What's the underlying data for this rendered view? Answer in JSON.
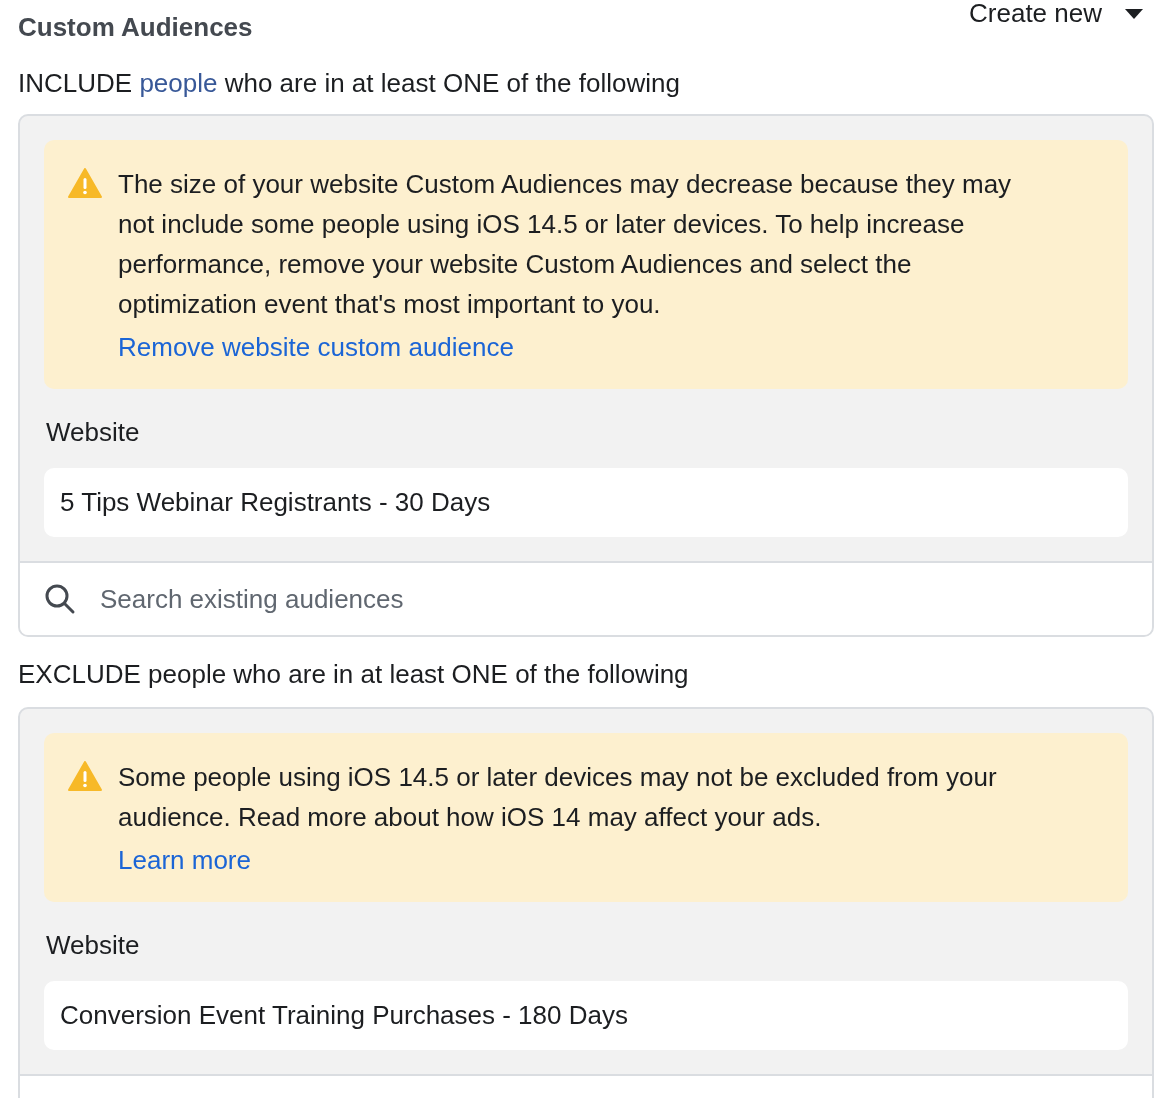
{
  "title": "Custom Audiences",
  "create_button": {
    "label": "Create new"
  },
  "sections": [
    {
      "heading": {
        "before": "INCLUDE",
        "link": "people",
        "after": "who are in at least ONE of the following"
      },
      "warning": {
        "text": "The size of your website Custom Audiences may decrease because they may not include some people using iOS 14.5 or later devices. To help increase performance, remove your website Custom Audiences and select the optimization event that's most important to you.",
        "link": "Remove website custom audience"
      },
      "group_label": "Website",
      "audiences": [
        "5 Tips Webinar Registrants - 30 Days"
      ],
      "search": {
        "placeholder": "Search existing audiences"
      }
    },
    {
      "heading": {
        "before": "EXCLUDE people who are in at least ONE of the following"
      },
      "warning": {
        "text": "Some people using iOS 14.5 or later devices may not be excluded from your audience. Read more about how iOS 14 may affect your ads.",
        "link": "Learn more"
      },
      "group_label": "Website",
      "audiences": [
        "Conversion Event Training Purchases - 180 Days"
      ]
    }
  ]
}
